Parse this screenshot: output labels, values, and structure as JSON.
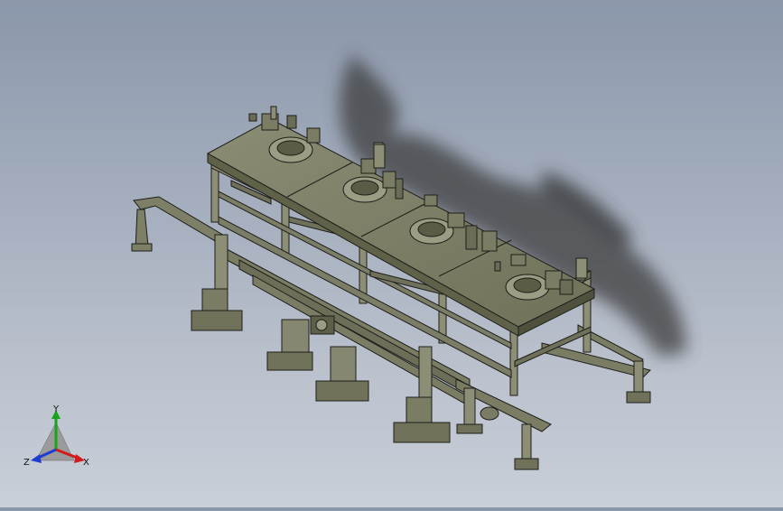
{
  "viewport": {
    "background_top": "#8b97aa",
    "background_bottom": "#c9cfd8",
    "model_color": "#7e8068",
    "edge_color": "#1e1e1a",
    "stations": [
      "station-1",
      "station-2",
      "station-3",
      "station-4"
    ]
  },
  "triad": {
    "x_label": "X",
    "y_label": "Y",
    "z_label": "Z",
    "x_color": "#d01c1c",
    "y_color": "#19a319",
    "z_color": "#1f3bd0"
  }
}
